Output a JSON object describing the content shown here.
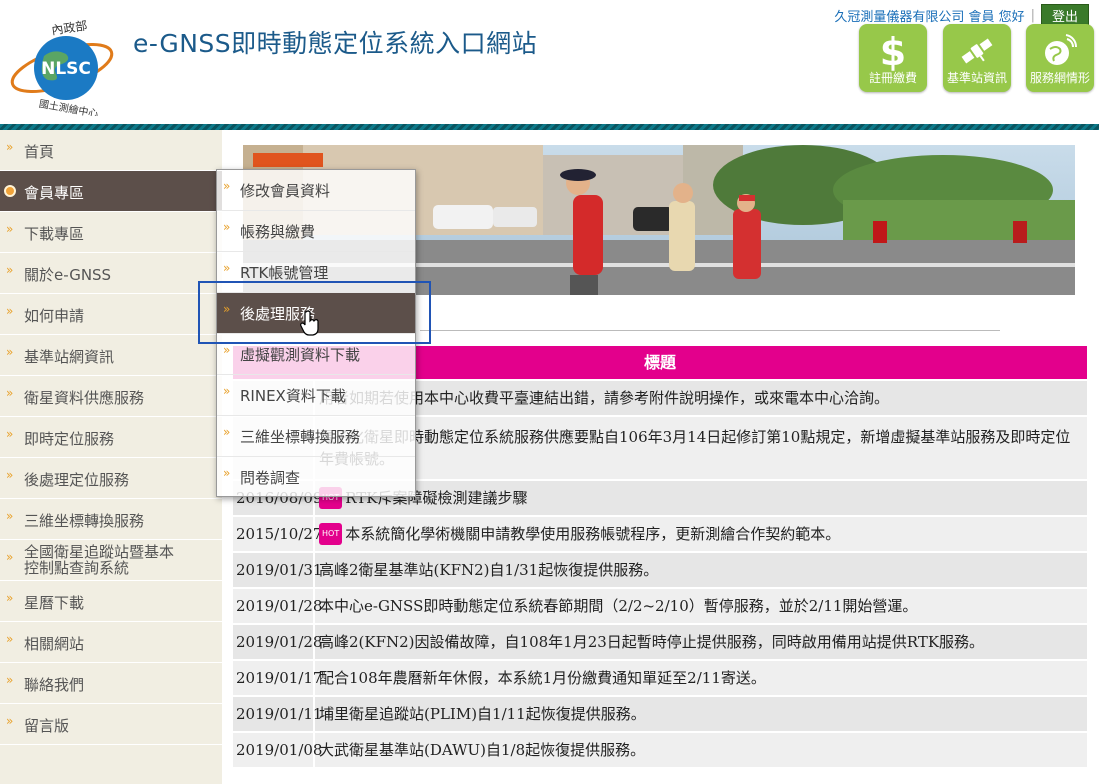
{
  "header": {
    "logo_top_text": "內政部",
    "logo_center_text": "NLSC",
    "logo_bottom_text": "國土測繪中心",
    "site_title": "e-GNSS即時動態定位系統入口網站",
    "user_greeting": "久冠測量儀器有限公司 會員 您好",
    "separator": "|",
    "logout_label": "登出",
    "quick_buttons": [
      {
        "label": "註冊繳費",
        "icon": "dollar-icon"
      },
      {
        "label": "基準站資訊",
        "icon": "satellite-icon"
      },
      {
        "label": "服務網情形",
        "icon": "globe-signal-icon"
      }
    ]
  },
  "sidebar": {
    "items": [
      {
        "label": "首頁"
      },
      {
        "label": "會員專區",
        "active": true
      },
      {
        "label": "下載專區"
      },
      {
        "label": "關於e-GNSS"
      },
      {
        "label": "如何申請"
      },
      {
        "label": "基準站網資訊"
      },
      {
        "label": "衛星資料供應服務"
      },
      {
        "label": "即時定位服務"
      },
      {
        "label": "後處理定位服務"
      },
      {
        "label": "三維坐標轉換服務"
      },
      {
        "label_line1": "全國衛星追蹤站暨基本",
        "label_line2": "控制點查詢系統"
      },
      {
        "label": "星曆下載"
      },
      {
        "label": "相關網站"
      },
      {
        "label": "聯絡我們"
      },
      {
        "label": "留言版"
      }
    ]
  },
  "submenu": {
    "items": [
      {
        "label": "修改會員資料"
      },
      {
        "label": "帳務與繳費"
      },
      {
        "label": "RTK帳號管理"
      },
      {
        "label": "後處理服務",
        "highlighted": true
      },
      {
        "label": "虛擬觀測資料下載"
      },
      {
        "label": "RINEX資料下載"
      },
      {
        "label": "三維坐標轉換服務"
      },
      {
        "label": "問卷調查"
      }
    ]
  },
  "news": {
    "header": "標題",
    "hot_badge": "HOT",
    "rows": [
      {
        "date": "",
        "title": "用者如期若使用本中心收費平臺連結出錯，請參考附件說明操作，或來電本中心洽詢。"
      },
      {
        "date": "",
        "title": "電子化衛星即時動態定位系統服務供應要點自106年3月14日起修訂第10點規定，新增虛擬基準站服務及即時定位年費帳號。"
      },
      {
        "date": "2016/08/09",
        "title": "RTK斥案障礙檢測建議步驟",
        "hot": true
      },
      {
        "date": "2015/10/27",
        "title": "本系統簡化學術機關申請教學使用服務帳號程序，更新測繪合作契約範本。",
        "hot": true
      },
      {
        "date": "2019/01/31",
        "title": "高峰2衛星基準站(KFN2)自1/31起恢復提供服務。"
      },
      {
        "date": "2019/01/28",
        "title": "本中心e-GNSS即時動態定位系統春節期間（2/2~2/10）暫停服務，並於2/11開始營運。"
      },
      {
        "date": "2019/01/28",
        "title": "高峰2(KFN2)因設備故障，自108年1月23日起暫時停止提供服務，同時啟用備用站提供RTK服務。"
      },
      {
        "date": "2019/01/17",
        "title": "配合108年農曆新年休假，本系統1月份繳費通知單延至2/11寄送。"
      },
      {
        "date": "2019/01/11",
        "title": "埔里衛星追蹤站(PLIM)自1/11起恢復提供服務。"
      },
      {
        "date": "2019/01/08",
        "title": "大武衛星基準站(DAWU)自1/8起恢復提供服務。"
      }
    ]
  },
  "colors": {
    "accent_magenta": "#e3008c",
    "sidebar_bg": "#f1eee2",
    "active_bg": "#5c4f4a",
    "quick_btn_green": "#97c84a",
    "title_blue": "#1b5a8a"
  }
}
